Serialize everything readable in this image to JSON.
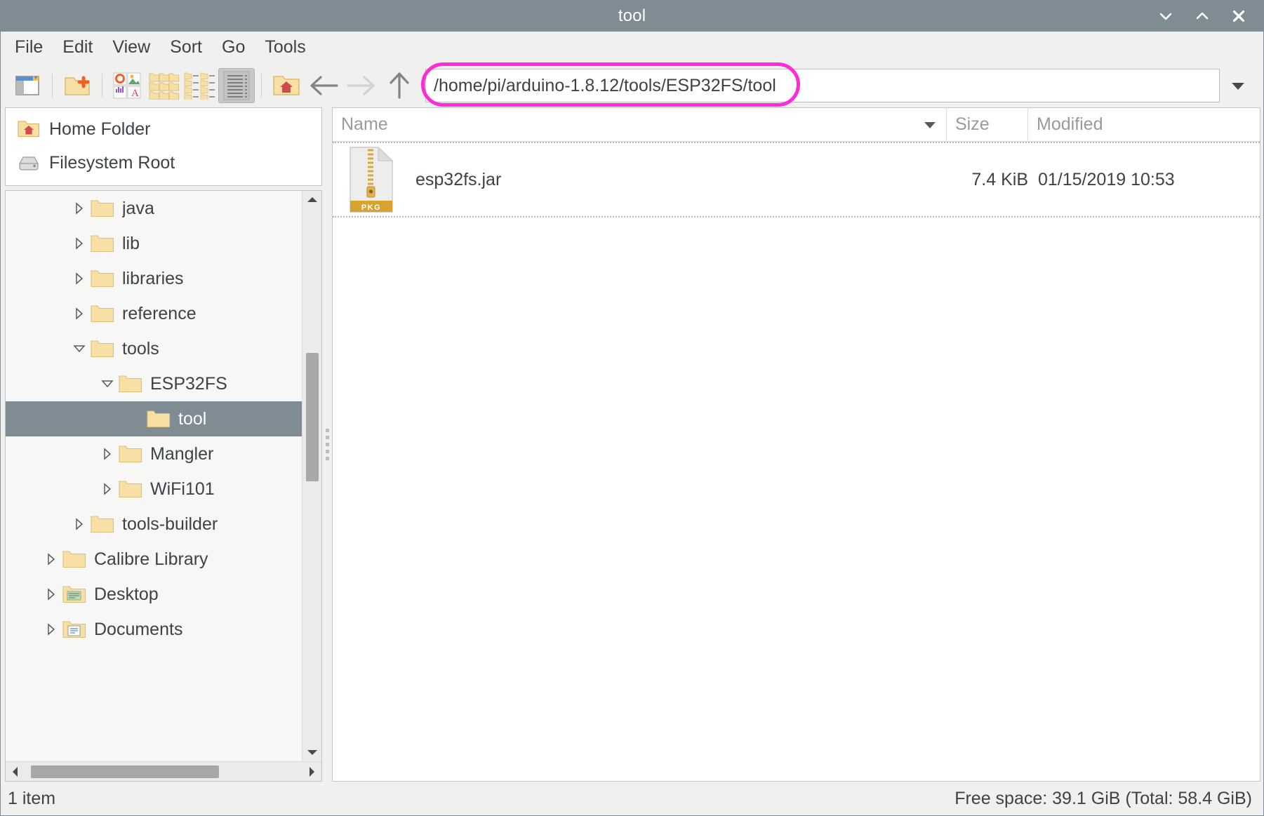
{
  "window": {
    "title": "tool",
    "buttons": [
      {
        "name": "minimize",
        "icon": "chevron-down-icon"
      },
      {
        "name": "maximize",
        "icon": "chevron-up-icon"
      },
      {
        "name": "close",
        "icon": "close-icon"
      }
    ]
  },
  "menubar": {
    "items": [
      "File",
      "Edit",
      "View",
      "Sort",
      "Go",
      "Tools"
    ]
  },
  "toolbar": {
    "buttons": [
      {
        "name": "toggle-sidebar-button",
        "icon": "sidebar-icon"
      },
      {
        "name": "new-folder-button",
        "icon": "new-folder-icon"
      },
      {
        "name": "thumbnail-view-button",
        "icon": "thumbnail-view-icon"
      },
      {
        "name": "icon-view-button",
        "icon": "icon-view-icon"
      },
      {
        "name": "compact-view-button",
        "icon": "compact-view-icon"
      },
      {
        "name": "detailed-list-view-button",
        "icon": "detailed-list-icon",
        "pressed": true
      },
      {
        "name": "home-button",
        "icon": "home-folder-icon"
      }
    ],
    "navigation": {
      "back": {
        "icon": "arrow-left-icon",
        "enabled": true
      },
      "forward": {
        "icon": "arrow-right-icon",
        "enabled": false
      },
      "up": {
        "icon": "arrow-up-icon",
        "enabled": true
      }
    },
    "path_entry": {
      "value": "/home/pi/arduino-1.8.12/tools/ESP32FS/tool",
      "placeholder": "",
      "highlighted": true,
      "highlight_color": "#ff2bd6"
    },
    "path_dropdown": {
      "icon": "chevron-down-icon"
    }
  },
  "sidebar": {
    "places": [
      {
        "label": "Home Folder",
        "icon": "home-folder-icon"
      },
      {
        "label": "Filesystem Root",
        "icon": "harddisk-icon"
      }
    ],
    "tree": [
      {
        "label": "java",
        "indent": 2,
        "expander": "collapsed",
        "icon": "folder-icon",
        "selected": false
      },
      {
        "label": "lib",
        "indent": 2,
        "expander": "collapsed",
        "icon": "folder-icon",
        "selected": false
      },
      {
        "label": "libraries",
        "indent": 2,
        "expander": "collapsed",
        "icon": "folder-icon",
        "selected": false
      },
      {
        "label": "reference",
        "indent": 2,
        "expander": "collapsed",
        "icon": "folder-icon",
        "selected": false
      },
      {
        "label": "tools",
        "indent": 2,
        "expander": "expanded",
        "icon": "folder-icon",
        "selected": false
      },
      {
        "label": "ESP32FS",
        "indent": 3,
        "expander": "expanded",
        "icon": "folder-icon",
        "selected": false
      },
      {
        "label": "tool",
        "indent": 4,
        "expander": "none",
        "icon": "folder-icon",
        "selected": true
      },
      {
        "label": "Mangler",
        "indent": 3,
        "expander": "collapsed",
        "icon": "folder-icon",
        "selected": false
      },
      {
        "label": "WiFi101",
        "indent": 3,
        "expander": "collapsed",
        "icon": "folder-icon",
        "selected": false
      },
      {
        "label": "tools-builder",
        "indent": 2,
        "expander": "collapsed",
        "icon": "folder-icon",
        "selected": false
      },
      {
        "label": "Calibre Library",
        "indent": 1,
        "expander": "collapsed",
        "icon": "folder-icon",
        "selected": false
      },
      {
        "label": "Desktop",
        "indent": 1,
        "expander": "collapsed",
        "icon": "folder-desktop-icon",
        "selected": false
      },
      {
        "label": "Documents",
        "indent": 1,
        "expander": "collapsed",
        "icon": "folder-documents-icon",
        "selected": false
      }
    ]
  },
  "file_view": {
    "columns": [
      {
        "key": "name",
        "label": "Name",
        "sorted": true,
        "sort_icon": "triangle-down-icon"
      },
      {
        "key": "size",
        "label": "Size"
      },
      {
        "key": "modified",
        "label": "Modified"
      }
    ],
    "rows": [
      {
        "name": "esp32fs.jar",
        "size": "7.4 KiB",
        "modified": "01/15/2019 10:53",
        "icon": "package-archive-icon",
        "icon_badge": "PKG"
      }
    ]
  },
  "statusbar": {
    "left": "1 item",
    "right": "Free space: 39.1 GiB (Total: 58.4 GiB)"
  },
  "colors": {
    "titlebar": "#7f8c93",
    "selection": "#7f8c93",
    "chrome": "#f0f0ef",
    "folder": "#f7dfa5",
    "highlight": "#ff2bd6"
  }
}
